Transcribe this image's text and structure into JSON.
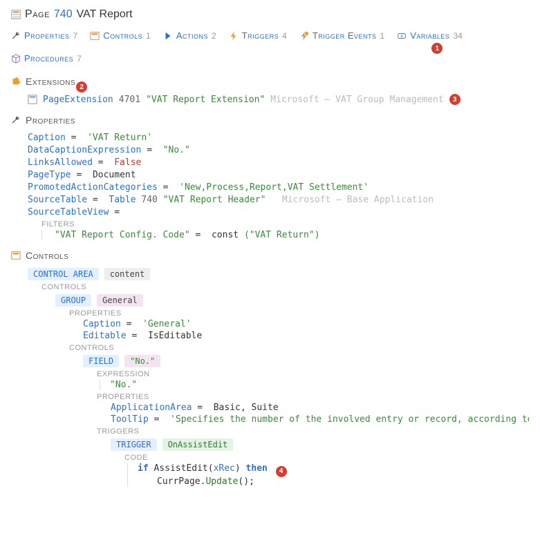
{
  "header": {
    "word_page": "Page",
    "number": "740",
    "name": "VAT Report"
  },
  "tabs": [
    {
      "label": "Properties",
      "count": "7"
    },
    {
      "label": "Controls",
      "count": "1"
    },
    {
      "label": "Actions",
      "count": "2"
    },
    {
      "label": "Triggers",
      "count": "4"
    },
    {
      "label": "Trigger Events",
      "count": "1"
    },
    {
      "label": "Variables",
      "count": "34"
    },
    {
      "label": "Procedures",
      "count": "7"
    }
  ],
  "badges": {
    "b1": "1",
    "b2": "2",
    "b3": "3",
    "b4": "4"
  },
  "sections": {
    "extensions": "Extensions",
    "properties": "Properties",
    "controls": "Controls"
  },
  "extension": {
    "type": "PageExtension",
    "id": "4701",
    "name": "\"VAT Report Extension\"",
    "source": "Microsoft — VAT Group Management"
  },
  "properties": [
    {
      "name": "Caption",
      "value": "'VAT Return'",
      "kind": "str"
    },
    {
      "name": "DataCaptionExpression",
      "value": "\"No.\"",
      "kind": "str"
    },
    {
      "name": "LinksAllowed",
      "value": "False",
      "kind": "kw"
    },
    {
      "name": "PageType",
      "value": "Document",
      "kind": "plain"
    },
    {
      "name": "PromotedActionCategories",
      "value": "'New,Process,Report,VAT Settlement'",
      "kind": "str"
    }
  ],
  "sourceTable": {
    "propName": "SourceTable",
    "tableWord": "Table",
    "tableId": "740",
    "tableName": "\"VAT Report Header\"",
    "tableSource": "Microsoft — Base Application"
  },
  "sourceTableView": {
    "propName": "SourceTableView",
    "filtersLabel": "FILTERS",
    "filterField": "\"VAT Report Config. Code\"",
    "filterOp": "const",
    "filterValue": "(\"VAT Return\")"
  },
  "controlArea": {
    "chipLabel": "CONTROL AREA",
    "areaName": "content",
    "controlsLabel": "CONTROLS"
  },
  "group": {
    "chipLabel": "GROUP",
    "groupName": "General",
    "propsLabel": "PROPERTIES",
    "props": [
      {
        "name": "Caption",
        "value": "'General'",
        "kind": "str"
      },
      {
        "name": "Editable",
        "value": "IsEditable",
        "kind": "plain"
      }
    ],
    "controlsLabel": "CONTROLS"
  },
  "field": {
    "chipLabel": "FIELD",
    "fieldName": "\"No.\"",
    "exprLabel": "EXPRESSION",
    "exprValue": "\"No.\"",
    "propsLabel": "PROPERTIES",
    "props": [
      {
        "name": "ApplicationArea",
        "value": "Basic, Suite",
        "kind": "plain"
      },
      {
        "name": "ToolTip",
        "value": "'Specifies the number of the involved entry or record, according to the specified",
        "kind": "str"
      }
    ],
    "triggersLabel": "TRIGGERS"
  },
  "trigger": {
    "chipLabel": "TRIGGER",
    "triggerName": "OnAssistEdit",
    "codeLabel": "CODE",
    "line1_if": "if",
    "line1_call": "AssistEdit(",
    "line1_arg": "xRec",
    "line1_close": ")",
    "line1_then": "then",
    "line2_obj": "CurrPage",
    "line2_dot": ".",
    "line2_method": "Update",
    "line2_paren": "();"
  }
}
